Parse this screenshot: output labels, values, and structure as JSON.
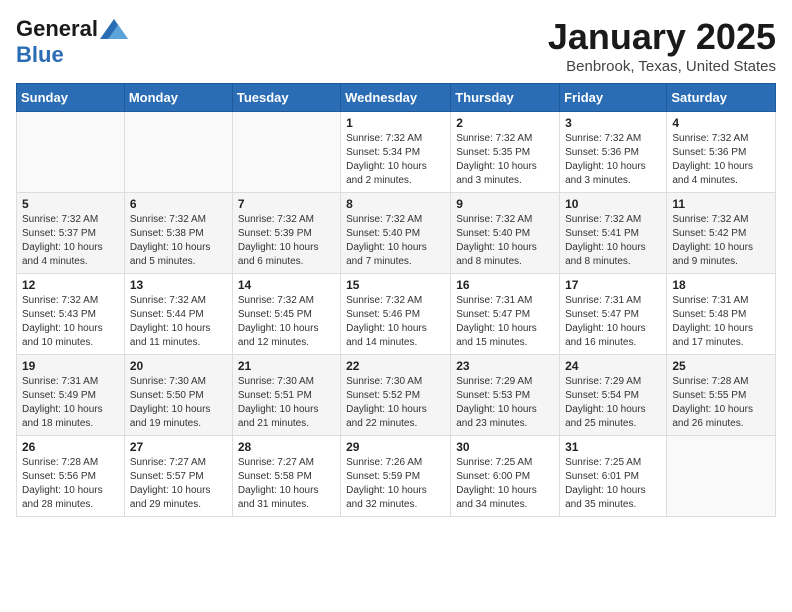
{
  "logo": {
    "general": "General",
    "blue": "Blue"
  },
  "header": {
    "title": "January 2025",
    "subtitle": "Benbrook, Texas, United States"
  },
  "days_of_week": [
    "Sunday",
    "Monday",
    "Tuesday",
    "Wednesday",
    "Thursday",
    "Friday",
    "Saturday"
  ],
  "weeks": [
    [
      {
        "day": "",
        "info": ""
      },
      {
        "day": "",
        "info": ""
      },
      {
        "day": "",
        "info": ""
      },
      {
        "day": "1",
        "info": "Sunrise: 7:32 AM\nSunset: 5:34 PM\nDaylight: 10 hours and 2 minutes."
      },
      {
        "day": "2",
        "info": "Sunrise: 7:32 AM\nSunset: 5:35 PM\nDaylight: 10 hours and 3 minutes."
      },
      {
        "day": "3",
        "info": "Sunrise: 7:32 AM\nSunset: 5:36 PM\nDaylight: 10 hours and 3 minutes."
      },
      {
        "day": "4",
        "info": "Sunrise: 7:32 AM\nSunset: 5:36 PM\nDaylight: 10 hours and 4 minutes."
      }
    ],
    [
      {
        "day": "5",
        "info": "Sunrise: 7:32 AM\nSunset: 5:37 PM\nDaylight: 10 hours and 4 minutes."
      },
      {
        "day": "6",
        "info": "Sunrise: 7:32 AM\nSunset: 5:38 PM\nDaylight: 10 hours and 5 minutes."
      },
      {
        "day": "7",
        "info": "Sunrise: 7:32 AM\nSunset: 5:39 PM\nDaylight: 10 hours and 6 minutes."
      },
      {
        "day": "8",
        "info": "Sunrise: 7:32 AM\nSunset: 5:40 PM\nDaylight: 10 hours and 7 minutes."
      },
      {
        "day": "9",
        "info": "Sunrise: 7:32 AM\nSunset: 5:40 PM\nDaylight: 10 hours and 8 minutes."
      },
      {
        "day": "10",
        "info": "Sunrise: 7:32 AM\nSunset: 5:41 PM\nDaylight: 10 hours and 8 minutes."
      },
      {
        "day": "11",
        "info": "Sunrise: 7:32 AM\nSunset: 5:42 PM\nDaylight: 10 hours and 9 minutes."
      }
    ],
    [
      {
        "day": "12",
        "info": "Sunrise: 7:32 AM\nSunset: 5:43 PM\nDaylight: 10 hours and 10 minutes."
      },
      {
        "day": "13",
        "info": "Sunrise: 7:32 AM\nSunset: 5:44 PM\nDaylight: 10 hours and 11 minutes."
      },
      {
        "day": "14",
        "info": "Sunrise: 7:32 AM\nSunset: 5:45 PM\nDaylight: 10 hours and 12 minutes."
      },
      {
        "day": "15",
        "info": "Sunrise: 7:32 AM\nSunset: 5:46 PM\nDaylight: 10 hours and 14 minutes."
      },
      {
        "day": "16",
        "info": "Sunrise: 7:31 AM\nSunset: 5:47 PM\nDaylight: 10 hours and 15 minutes."
      },
      {
        "day": "17",
        "info": "Sunrise: 7:31 AM\nSunset: 5:47 PM\nDaylight: 10 hours and 16 minutes."
      },
      {
        "day": "18",
        "info": "Sunrise: 7:31 AM\nSunset: 5:48 PM\nDaylight: 10 hours and 17 minutes."
      }
    ],
    [
      {
        "day": "19",
        "info": "Sunrise: 7:31 AM\nSunset: 5:49 PM\nDaylight: 10 hours and 18 minutes."
      },
      {
        "day": "20",
        "info": "Sunrise: 7:30 AM\nSunset: 5:50 PM\nDaylight: 10 hours and 19 minutes."
      },
      {
        "day": "21",
        "info": "Sunrise: 7:30 AM\nSunset: 5:51 PM\nDaylight: 10 hours and 21 minutes."
      },
      {
        "day": "22",
        "info": "Sunrise: 7:30 AM\nSunset: 5:52 PM\nDaylight: 10 hours and 22 minutes."
      },
      {
        "day": "23",
        "info": "Sunrise: 7:29 AM\nSunset: 5:53 PM\nDaylight: 10 hours and 23 minutes."
      },
      {
        "day": "24",
        "info": "Sunrise: 7:29 AM\nSunset: 5:54 PM\nDaylight: 10 hours and 25 minutes."
      },
      {
        "day": "25",
        "info": "Sunrise: 7:28 AM\nSunset: 5:55 PM\nDaylight: 10 hours and 26 minutes."
      }
    ],
    [
      {
        "day": "26",
        "info": "Sunrise: 7:28 AM\nSunset: 5:56 PM\nDaylight: 10 hours and 28 minutes."
      },
      {
        "day": "27",
        "info": "Sunrise: 7:27 AM\nSunset: 5:57 PM\nDaylight: 10 hours and 29 minutes."
      },
      {
        "day": "28",
        "info": "Sunrise: 7:27 AM\nSunset: 5:58 PM\nDaylight: 10 hours and 31 minutes."
      },
      {
        "day": "29",
        "info": "Sunrise: 7:26 AM\nSunset: 5:59 PM\nDaylight: 10 hours and 32 minutes."
      },
      {
        "day": "30",
        "info": "Sunrise: 7:25 AM\nSunset: 6:00 PM\nDaylight: 10 hours and 34 minutes."
      },
      {
        "day": "31",
        "info": "Sunrise: 7:25 AM\nSunset: 6:01 PM\nDaylight: 10 hours and 35 minutes."
      },
      {
        "day": "",
        "info": ""
      }
    ]
  ]
}
